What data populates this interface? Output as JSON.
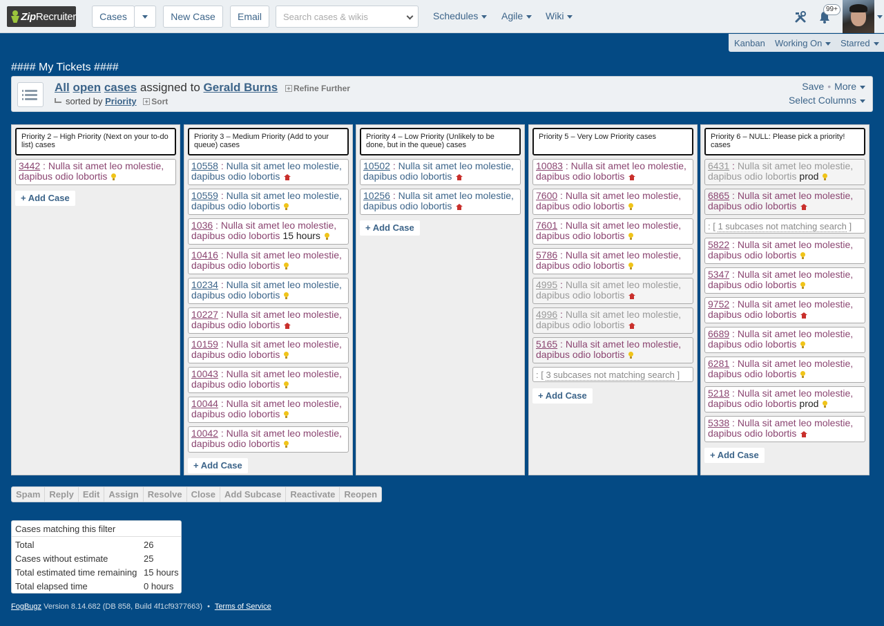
{
  "brand": {
    "name_bold": "Zip",
    "name_rest": "Recruiter"
  },
  "topnav": {
    "cases_label": "Cases",
    "new_case_label": "New Case",
    "email_label": "Email",
    "search_placeholder": "Search cases & wikis",
    "schedules_label": "Schedules",
    "agile_label": "Agile",
    "wiki_label": "Wiki",
    "notification_count": "99+"
  },
  "subnav": {
    "kanban": "Kanban",
    "working_on": "Working On",
    "starred": "Starred"
  },
  "page_title": "#### My Tickets ####",
  "filter": {
    "all": "All",
    "open": "open",
    "cases": "cases",
    "assigned_to": "assigned to",
    "user": "Gerald Burns",
    "refine": "Refine Further",
    "sorted_by": "sorted by",
    "sort_field": "Priority",
    "sort_label": "Sort",
    "save": "Save",
    "more": "More",
    "select_columns": "Select Columns"
  },
  "columns": [
    {
      "title": "Priority 2 – High Priority (Next on your to-do list) cases",
      "cards": [
        {
          "num": "3442",
          "text": "Nulla sit amet leo molestie, dapibus odio lobortis",
          "icon": "bulb-icon",
          "style": "normal",
          "extra": ""
        }
      ],
      "add_label": "+ Add Case"
    },
    {
      "title": "Priority 3 – Medium Priority (Add to your queue) cases",
      "cards": [
        {
          "num": "10558",
          "text": "Nulla sit amet leo molestie, dapibus odio lobortis",
          "icon": "house-icon",
          "style": "prio3",
          "extra": ""
        },
        {
          "num": "10559",
          "text": "Nulla sit amet leo molestie, dapibus odio lobortis",
          "icon": "bulb-icon",
          "style": "prio3",
          "extra": ""
        },
        {
          "num": "1036",
          "text": "Nulla sit amet leo molestie, dapibus odio lobortis",
          "icon": "bulb-icon",
          "style": "normal",
          "extra": "15 hours"
        },
        {
          "num": "10416",
          "text": "Nulla sit amet leo molestie, dapibus odio lobortis",
          "icon": "bulb-icon",
          "style": "normal",
          "extra": ""
        },
        {
          "num": "10234",
          "text": "Nulla sit amet leo molestie, dapibus odio lobortis",
          "icon": "bulb-icon",
          "style": "prio3",
          "extra": ""
        },
        {
          "num": "10227",
          "text": "Nulla sit amet leo molestie, dapibus odio lobortis",
          "icon": "house-icon",
          "style": "normal",
          "extra": ""
        },
        {
          "num": "10159",
          "text": "Nulla sit amet leo molestie, dapibus odio lobortis",
          "icon": "bulb-icon",
          "style": "normal",
          "extra": ""
        },
        {
          "num": "10043",
          "text": "Nulla sit amet leo molestie, dapibus odio lobortis",
          "icon": "bulb-icon",
          "style": "normal",
          "extra": ""
        },
        {
          "num": "10044",
          "text": "Nulla sit amet leo molestie, dapibus odio lobortis",
          "icon": "bulb-icon",
          "style": "normal",
          "extra": ""
        },
        {
          "num": "10042",
          "text": "Nulla sit amet leo molestie, dapibus odio lobortis",
          "icon": "bulb-icon",
          "style": "normal",
          "extra": ""
        }
      ],
      "add_label": "+ Add Case"
    },
    {
      "title": "Priority 4 – Low Priority (Unlikely to be done, but in the queue) cases",
      "cards": [
        {
          "num": "10502",
          "text": "Nulla sit amet leo molestie, dapibus odio lobortis",
          "icon": "house-icon",
          "style": "prio3",
          "extra": ""
        },
        {
          "num": "10256",
          "text": "Nulla sit amet leo molestie, dapibus odio lobortis",
          "icon": "house-icon",
          "style": "prio3",
          "extra": ""
        }
      ],
      "add_label": "+ Add Case"
    },
    {
      "title": "Priority 5 – Very Low Priority cases",
      "cards": [
        {
          "num": "10083",
          "text": "Nulla sit amet leo molestie, dapibus odio lobortis",
          "icon": "house-icon",
          "style": "normal",
          "extra": ""
        },
        {
          "num": "7600",
          "text": "Nulla sit amet leo molestie, dapibus odio lobortis",
          "icon": "bulb-icon",
          "style": "normal",
          "extra": ""
        },
        {
          "num": "7601",
          "text": "Nulla sit amet leo molestie, dapibus odio lobortis",
          "icon": "bulb-icon",
          "style": "normal",
          "extra": ""
        },
        {
          "num": "5786",
          "text": "Nulla sit amet leo molestie, dapibus odio lobortis",
          "icon": "bulb-icon",
          "style": "normal",
          "extra": ""
        },
        {
          "num": "4995",
          "text": "Nulla sit amet leo molestie, dapibus odio lobortis",
          "icon": "house-icon",
          "style": "grey",
          "extra": ""
        },
        {
          "num": "4996",
          "text": "Nulla sit amet leo molestie, dapibus odio lobortis",
          "icon": "house-icon",
          "style": "grey",
          "extra": ""
        },
        {
          "num": "5165",
          "text": "Nulla sit amet leo molestie, dapibus odio lobortis",
          "icon": "bulb-icon",
          "style": "grey2",
          "extra": ""
        }
      ],
      "subcases": "3 subcases not matching search",
      "add_label": "+ Add Case"
    },
    {
      "title": "Priority 6 – NULL: Please pick a priority! cases",
      "cards": [
        {
          "num": "6431",
          "text": "Nulla sit amet leo molestie, dapibus odio lobortis",
          "icon": "bulb-icon",
          "style": "grey",
          "extra": "prod"
        },
        {
          "num": "6865",
          "text": "Nulla sit amet leo molestie, dapibus odio lobortis",
          "icon": "house-icon",
          "style": "grey2",
          "extra": ""
        }
      ],
      "subcases": "1 subcases not matching search",
      "cards_after": [
        {
          "num": "5822",
          "text": "Nulla sit amet leo molestie, dapibus odio lobortis",
          "icon": "bulb-icon",
          "style": "normal",
          "extra": ""
        },
        {
          "num": "5347",
          "text": "Nulla sit amet leo molestie, dapibus odio lobortis",
          "icon": "bulb-icon",
          "style": "normal",
          "extra": ""
        },
        {
          "num": "9752",
          "text": "Nulla sit amet leo molestie, dapibus odio lobortis",
          "icon": "house-icon",
          "style": "normal",
          "extra": ""
        },
        {
          "num": "6689",
          "text": "Nulla sit amet leo molestie, dapibus odio lobortis",
          "icon": "bulb-icon",
          "style": "normal",
          "extra": ""
        },
        {
          "num": "6281",
          "text": "Nulla sit amet leo molestie, dapibus odio lobortis",
          "icon": "bulb-icon",
          "style": "normal",
          "extra": ""
        },
        {
          "num": "5218",
          "text": "Nulla sit amet leo molestie, dapibus odio lobortis",
          "icon": "bulb-icon",
          "style": "normal",
          "extra": "prod"
        },
        {
          "num": "5338",
          "text": "Nulla sit amet leo molestie, dapibus odio lobortis",
          "icon": "house-icon",
          "style": "normal",
          "extra": ""
        }
      ],
      "add_label": "+ Add Case"
    }
  ],
  "actions": [
    "Spam",
    "Reply",
    "Edit",
    "Assign",
    "Resolve",
    "Close",
    "Add Subcase",
    "Reactivate",
    "Reopen"
  ],
  "stats": {
    "header": "Cases matching this filter",
    "rows": [
      {
        "label": "Total",
        "value": "26"
      },
      {
        "label": "Cases without estimate",
        "value": "25"
      },
      {
        "label": "Total estimated time remaining",
        "value": "15 hours"
      },
      {
        "label": "Total elapsed time",
        "value": "0 hours"
      }
    ]
  },
  "footer": {
    "product": "FogBugz",
    "version": "Version 8.14.682 (DB 858, Build 4f1cf9377663)",
    "separator": "•",
    "terms": "Terms of Service"
  },
  "colors": {
    "page_bg": "#044a84",
    "link": "#3c6489",
    "case_text": "#8a4470",
    "bulb": "#f0c419",
    "house": "#c9302c"
  }
}
